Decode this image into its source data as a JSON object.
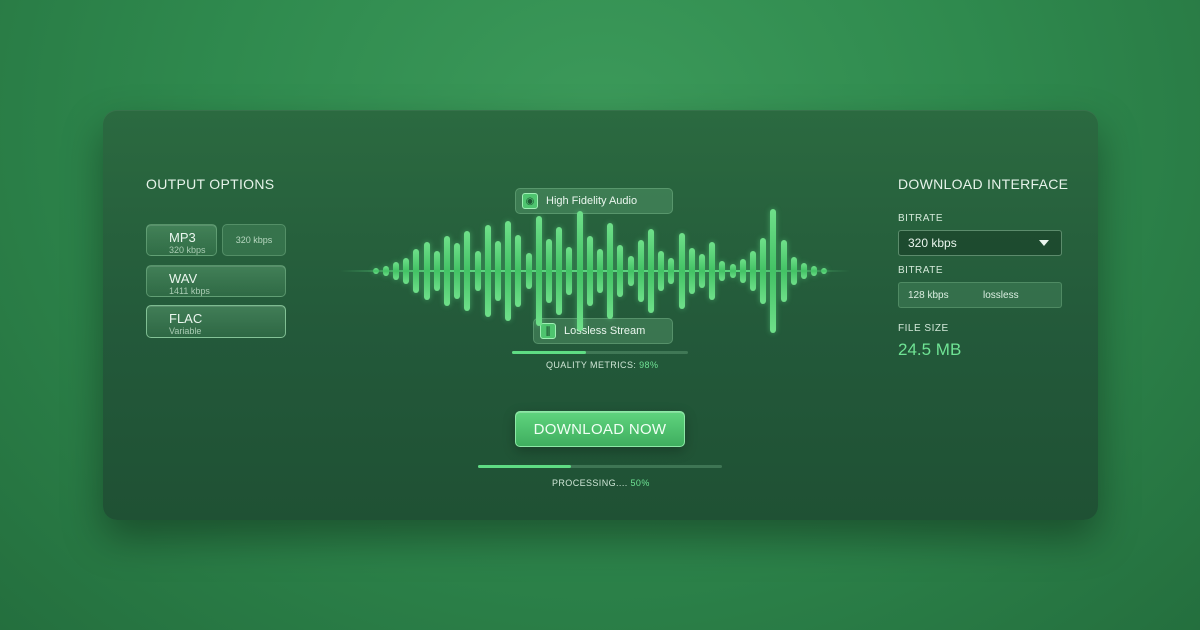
{
  "output_options": {
    "title": "OUTPUT OPTIONS",
    "formats": [
      {
        "name": "MP3",
        "detail": "320 kbps",
        "extra": "320 kbps"
      },
      {
        "name": "WAV",
        "detail": "1411 kbps"
      },
      {
        "name": "FLAC",
        "detail": "Variable"
      }
    ]
  },
  "center": {
    "chip_top": {
      "label": "High Fidelity Audio",
      "icon": "disc-icon"
    },
    "chip_bottom": {
      "label": "Lossless Stream",
      "icon": "stream-icon"
    },
    "quality": {
      "label": "QUALITY METRICS:",
      "value": "98%",
      "fraction": 0.98
    },
    "download_label": "DOWNLOAD NOW",
    "processing": {
      "label": "PROCESSING....",
      "value": "50%",
      "fraction": 0.5
    }
  },
  "download_interface": {
    "title": "DOWNLOAD INTERFACE",
    "bitrate_label": "BITRATE",
    "bitrate_selected": "320 kbps",
    "bitrate_label_2": "BITRATE",
    "bitrate_option_a": "128 kbps",
    "bitrate_option_b": "lossless",
    "filesize_label": "FILE SIZE",
    "filesize_value": "24.5 MB"
  },
  "colors": {
    "accent": "#5fdc84",
    "background": "#2f8a4e",
    "panel": "#23593a"
  }
}
